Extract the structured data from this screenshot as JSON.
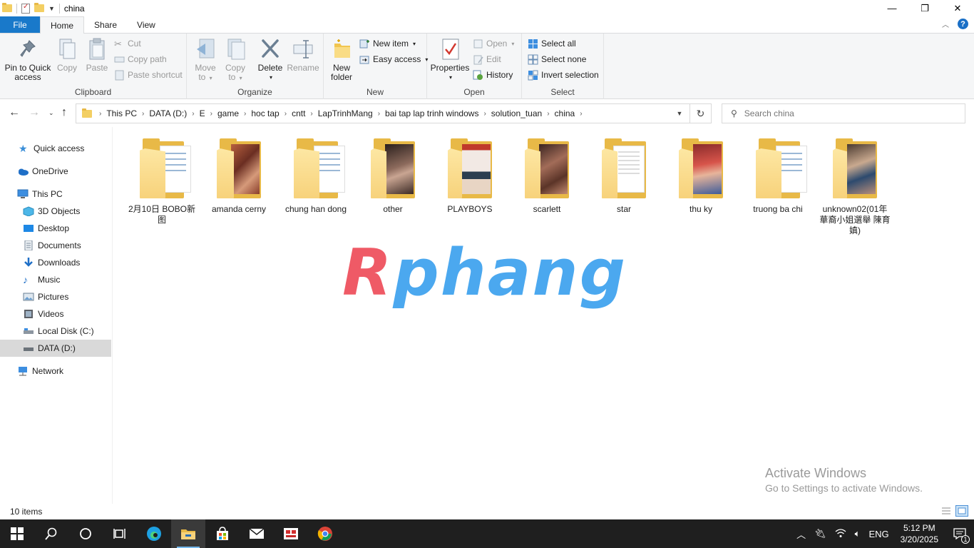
{
  "window": {
    "title": "china"
  },
  "tabs": [
    "File",
    "Home",
    "Share",
    "View"
  ],
  "ribbon": {
    "clipboard": {
      "label": "Clipboard",
      "pin": "Pin to Quick access",
      "pin_l1": "Pin to Quick",
      "pin_l2": "access",
      "copy": "Copy",
      "paste": "Paste",
      "cut": "Cut",
      "copy_path": "Copy path",
      "paste_shortcut": "Paste shortcut"
    },
    "organize": {
      "label": "Organize",
      "move_l1": "Move",
      "move_l2": "to",
      "copy_l1": "Copy",
      "copy_l2": "to",
      "delete": "Delete",
      "rename": "Rename"
    },
    "new": {
      "label": "New",
      "folder_l1": "New",
      "folder_l2": "folder",
      "new_item": "New item",
      "easy_access": "Easy access"
    },
    "open": {
      "label": "Open",
      "properties": "Properties",
      "open": "Open",
      "edit": "Edit",
      "history": "History"
    },
    "select": {
      "label": "Select",
      "select_all": "Select all",
      "select_none": "Select none",
      "invert": "Invert selection"
    }
  },
  "address": {
    "crumbs": [
      "This PC",
      "DATA (D:)",
      "E",
      "game",
      "hoc tap",
      "cntt",
      "LapTrinhMang",
      "bai tap lap trinh windows",
      "solution_tuan",
      "china"
    ],
    "search_placeholder": "Search china"
  },
  "nav": [
    {
      "label": "Quick access",
      "icon": "star-icon"
    },
    {
      "label": "OneDrive",
      "icon": "cloud-icon"
    },
    {
      "label": "This PC",
      "icon": "computer-icon"
    },
    {
      "label": "3D Objects",
      "icon": "cube-icon"
    },
    {
      "label": "Desktop",
      "icon": "desktop-icon"
    },
    {
      "label": "Documents",
      "icon": "document-icon"
    },
    {
      "label": "Downloads",
      "icon": "download-icon"
    },
    {
      "label": "Music",
      "icon": "music-icon"
    },
    {
      "label": "Pictures",
      "icon": "picture-icon"
    },
    {
      "label": "Videos",
      "icon": "video-icon"
    },
    {
      "label": "Local Disk (C:)",
      "icon": "drive-icon"
    },
    {
      "label": "DATA (D:)",
      "icon": "drive-icon"
    },
    {
      "label": "Network",
      "icon": "network-icon"
    }
  ],
  "files": [
    {
      "name": "2月10日 BOBO新图",
      "thumb": "docs"
    },
    {
      "name": "amanda cerny",
      "thumb": "photo"
    },
    {
      "name": "chung han dong",
      "thumb": "docs"
    },
    {
      "name": "other",
      "thumb": "photo"
    },
    {
      "name": "PLAYBOYS",
      "thumb": "photo"
    },
    {
      "name": "scarlett",
      "thumb": "photo"
    },
    {
      "name": "star",
      "thumb": "paper"
    },
    {
      "name": "thu ky",
      "thumb": "photo"
    },
    {
      "name": "truong ba chi",
      "thumb": "docs"
    },
    {
      "name": "unknown02(01年華裔小姐選舉 陳育嫃)",
      "thumb": "photo"
    }
  ],
  "watermark": {
    "part1": "R",
    "part2": "phang"
  },
  "activation": {
    "line1": "Activate Windows",
    "line2": "Go to Settings to activate Windows."
  },
  "status": {
    "count": "10 items"
  },
  "taskbar": {
    "lang": "ENG",
    "time": "5:12 PM",
    "date": "3/20/2025",
    "notif_count": "1"
  },
  "colors": {
    "accent": "#1979ca",
    "folder": "#f3cf63",
    "taskbar": "#1f1f1f"
  }
}
